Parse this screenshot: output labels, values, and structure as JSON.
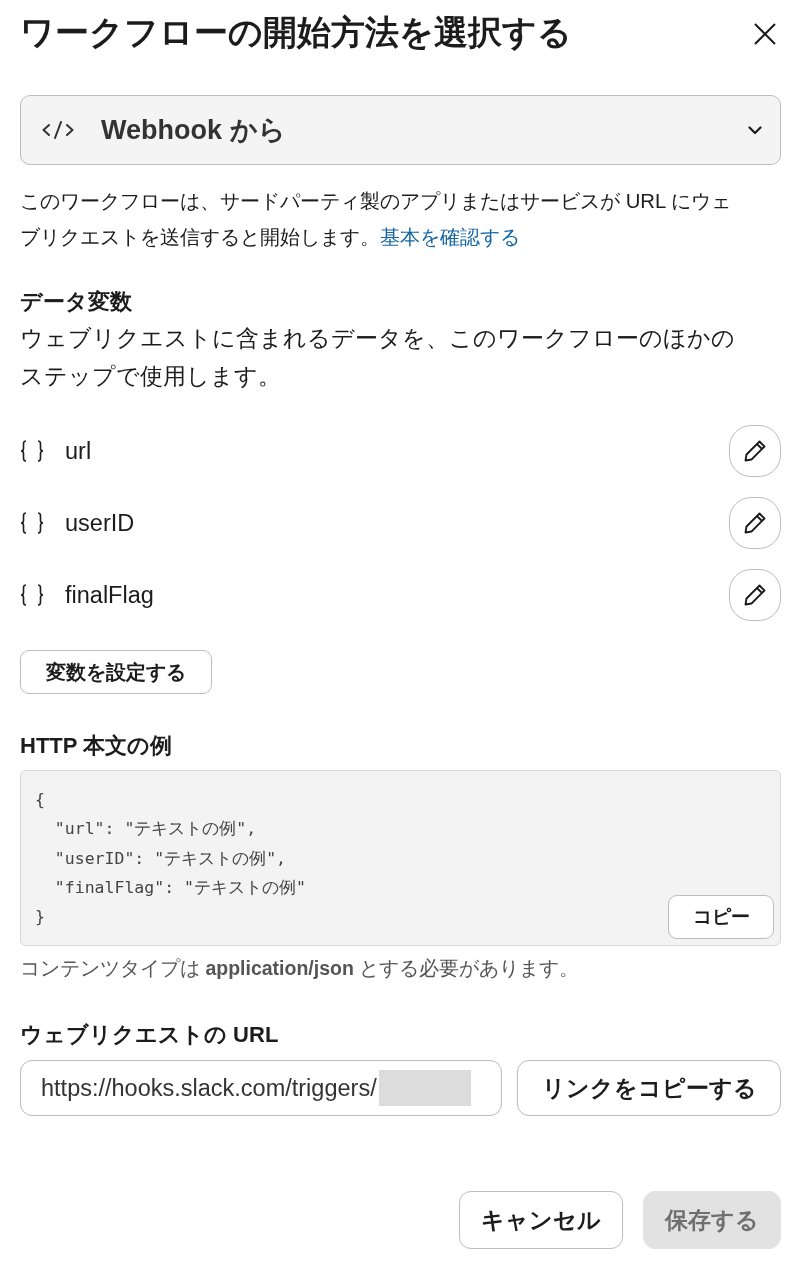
{
  "dialog": {
    "title": "ワークフローの開始方法を選択する"
  },
  "trigger_select": {
    "value": "Webhook から"
  },
  "description": {
    "text": "このワークフローは、サードパーティ製のアプリまたはサービスが URL にウェブリクエストを送信すると開始します。",
    "link": "基本を確認する"
  },
  "data_variables": {
    "heading": "データ変数",
    "description": "ウェブリクエストに含まれるデータを、このワークフローのほかのステップで使用します。",
    "variables": [
      {
        "name": "url"
      },
      {
        "name": "userID"
      },
      {
        "name": "finalFlag"
      }
    ],
    "set_button": "変数を設定する"
  },
  "http_body_example": {
    "heading": "HTTP 本文の例",
    "code_lines": [
      "{",
      "  \"url\": \"テキストの例\",",
      "  \"userID\": \"テキストの例\",",
      "  \"finalFlag\": \"テキストの例\"",
      "}"
    ],
    "copy_button": "コピー",
    "note": "コンテンツタイプは **application/json** とする必要があります。"
  },
  "webhook_url": {
    "heading": "ウェブリクエストの URL",
    "value": "https://hooks.slack.com/triggers/",
    "copy_button": "リンクをコピーする"
  },
  "footer": {
    "buttons": [
      {
        "label": "キャンセル",
        "disabled": false
      },
      {
        "label": "保存する",
        "disabled": true
      }
    ]
  }
}
